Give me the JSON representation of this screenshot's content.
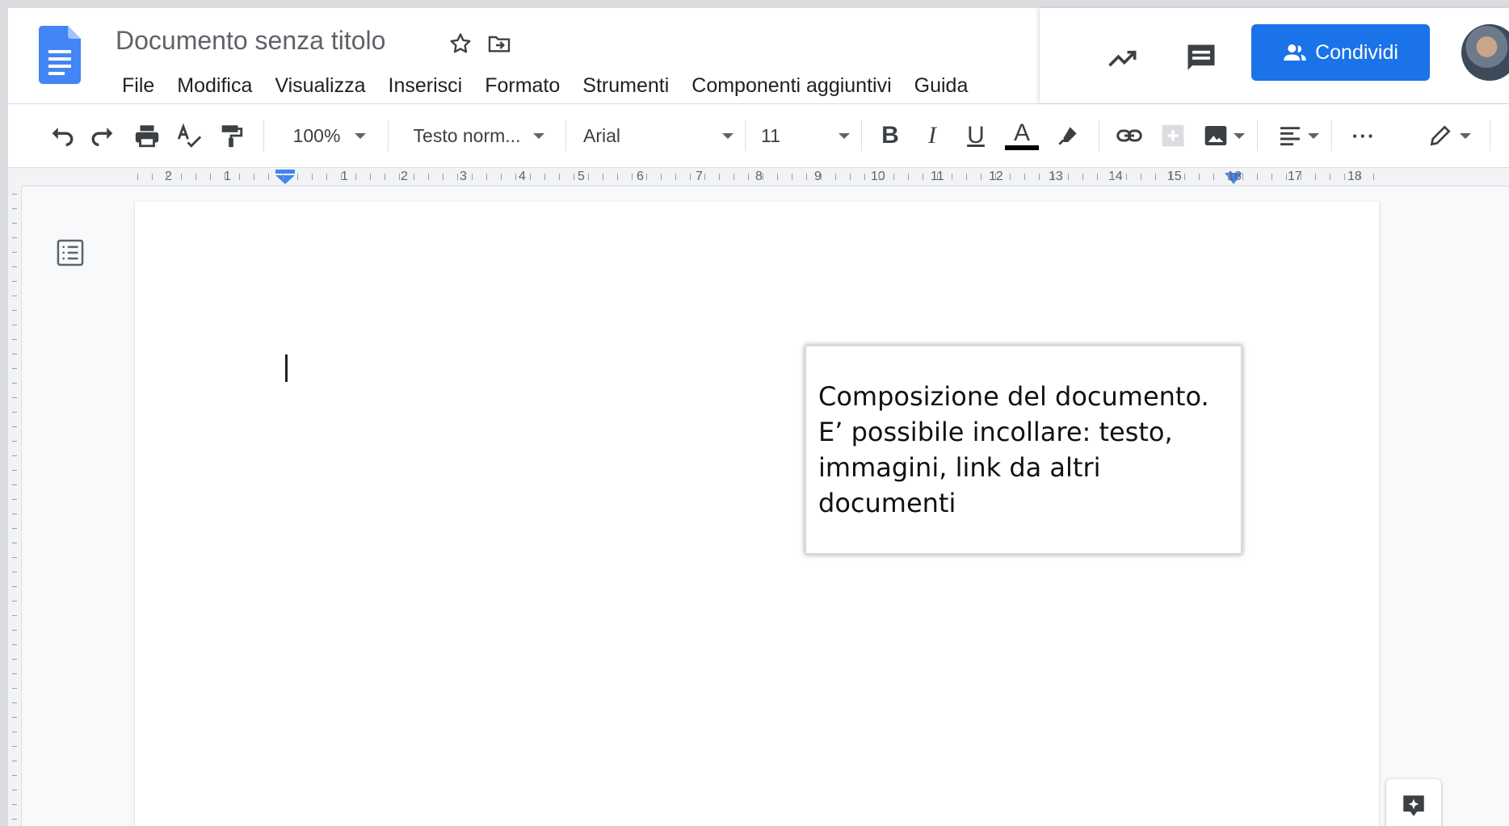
{
  "header": {
    "doc_title": "Documento senza titolo",
    "menu": [
      "File",
      "Modifica",
      "Visualizza",
      "Inserisci",
      "Formato",
      "Strumenti",
      "Componenti aggiuntivi",
      "Guida"
    ],
    "share_label": "Condividi"
  },
  "toolbar": {
    "zoom": "100%",
    "style": "Testo norm...",
    "font": "Arial",
    "font_size": "11",
    "bold": "B",
    "italic": "I",
    "underline": "U",
    "text_color": "A",
    "more": "···"
  },
  "ruler": {
    "numbers": [
      "2",
      "1",
      "1",
      "2",
      "3",
      "4",
      "5",
      "6",
      "7",
      "8",
      "9",
      "10",
      "11",
      "12",
      "13",
      "14",
      "15",
      "16",
      "17",
      "18"
    ]
  },
  "callout": {
    "text": "Composizione del documento. E’ possibile incollare: testo, immagini, link da altri documenti"
  },
  "colors": {
    "accent": "#1a73e8",
    "doc_icon": "#4285f4"
  },
  "icons": [
    "docs-logo-icon",
    "star-icon",
    "move-to-folder-icon",
    "activity-trend-icon",
    "comments-icon",
    "share-person-icon",
    "undo-icon",
    "redo-icon",
    "print-icon",
    "spellcheck-icon",
    "paint-format-icon",
    "link-icon",
    "add-comment-icon",
    "insert-image-icon",
    "align-icon",
    "edit-mode-pencil-icon",
    "outline-icon",
    "explore-icon"
  ]
}
